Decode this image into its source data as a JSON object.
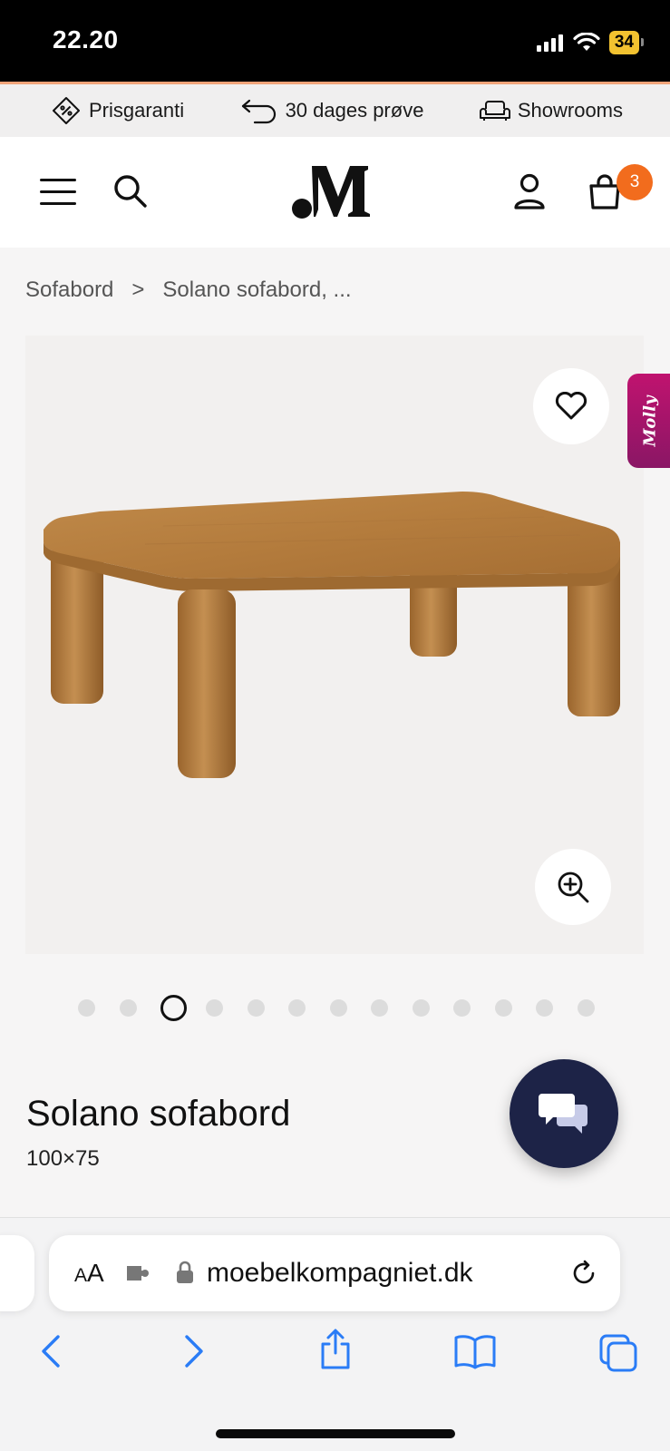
{
  "status_bar": {
    "time": "22.20",
    "battery": "34"
  },
  "usp": [
    {
      "icon": "price-tag-icon",
      "label": "Prisgaranti"
    },
    {
      "icon": "return-arrow-icon",
      "label": "30 dages prøve"
    },
    {
      "icon": "sofa-icon",
      "label": "Showrooms"
    }
  ],
  "header": {
    "logo": ".M",
    "cart_count": "3"
  },
  "breadcrumb": {
    "parent": "Sofabord",
    "separator": ">",
    "current": "Solano sofabord, ..."
  },
  "gallery": {
    "image_count": 13,
    "active_index": 2
  },
  "side_tab": {
    "label": "Molly"
  },
  "product": {
    "title": "Solano sofabord",
    "size": "100×75"
  },
  "browser": {
    "text_size_label_small": "A",
    "text_size_label_large": "A",
    "url": "moebelkompagniet.dk"
  },
  "colors": {
    "accent": "#f26c1d",
    "chat_bg": "#1d2347",
    "molly_bg": "#b0146c",
    "ios_blue": "#2a7cf6"
  }
}
